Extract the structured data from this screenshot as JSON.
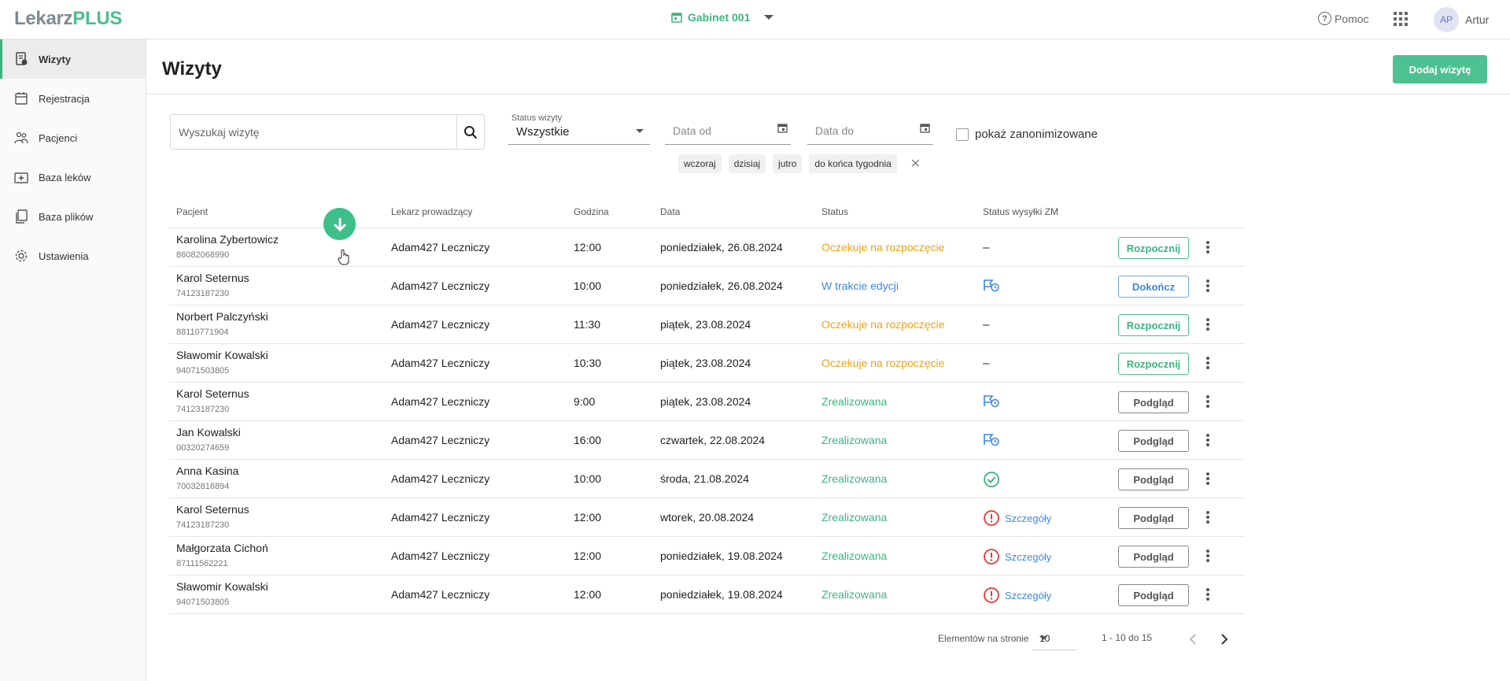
{
  "app": {
    "logo_main": "Lekarz",
    "logo_plus": "PLUS"
  },
  "topbar": {
    "cabinet": "Gabinet 001",
    "help": "Pomoc",
    "user_initials": "AP",
    "user_name": "Artur"
  },
  "sidebar": {
    "items": [
      {
        "label": "Wizyty",
        "icon": "document-icon",
        "active": true
      },
      {
        "label": "Rejestracja",
        "icon": "calendar-icon"
      },
      {
        "label": "Pacjenci",
        "icon": "people-icon"
      },
      {
        "label": "Baza leków",
        "icon": "medkit-icon"
      },
      {
        "label": "Baza plików",
        "icon": "files-icon"
      },
      {
        "label": "Ustawienia",
        "icon": "gear-icon"
      }
    ]
  },
  "header": {
    "title": "Wizyty",
    "add_button": "Dodaj wizytę"
  },
  "filters": {
    "search_placeholder": "Wyszukaj wizytę",
    "status_label": "Status wizyty",
    "status_value": "Wszystkie",
    "date_from": "Data od",
    "date_to": "Data do",
    "anon_label": "pokaż zanonimizowane",
    "chips": [
      "wczoraj",
      "dzisiaj",
      "jutro",
      "do końca tygodnia"
    ]
  },
  "table": {
    "headers": {
      "patient": "Pacjent",
      "doctor": "Lekarz prowadzący",
      "hour": "Godzina",
      "date": "Data",
      "status": "Status",
      "zm": "Status wysyłki ZM"
    },
    "rows": [
      {
        "name": "Karolina Zybertowicz",
        "pesel": "86082068990",
        "doctor": "Adam427 Leczniczy",
        "hour": "12:00",
        "date": "poniedziałek, 26.08.2024",
        "status": "Oczekuje na rozpoczęcie",
        "zm": "–",
        "action": "Rozpocznij"
      },
      {
        "name": "Karol Seternus",
        "pesel": "74123187230",
        "doctor": "Adam427 Leczniczy",
        "hour": "10:00",
        "date": "poniedziałek, 26.08.2024",
        "status": "W trakcie edycji",
        "zm": "",
        "action": "Dokończ"
      },
      {
        "name": "Norbert Palczyński",
        "pesel": "88110771904",
        "doctor": "Adam427 Leczniczy",
        "hour": "11:30",
        "date": "piątek, 23.08.2024",
        "status": "Oczekuje na rozpoczęcie",
        "zm": "–",
        "action": "Rozpocznij"
      },
      {
        "name": "Sławomir Kowalski",
        "pesel": "94071503805",
        "doctor": "Adam427 Leczniczy",
        "hour": "10:30",
        "date": "piątek, 23.08.2024",
        "status": "Oczekuje na rozpoczęcie",
        "zm": "–",
        "action": "Rozpocznij"
      },
      {
        "name": "Karol Seternus",
        "pesel": "74123187230",
        "doctor": "Adam427 Leczniczy",
        "hour": "9:00",
        "date": "piątek, 23.08.2024",
        "status": "Zrealizowana",
        "zm": "",
        "action": "Podgląd"
      },
      {
        "name": "Jan Kowalski",
        "pesel": "00320274659",
        "doctor": "Adam427 Leczniczy",
        "hour": "16:00",
        "date": "czwartek, 22.08.2024",
        "status": "Zrealizowana",
        "zm": "",
        "action": "Podgląd"
      },
      {
        "name": "Anna Kasina",
        "pesel": "70032816894",
        "doctor": "Adam427 Leczniczy",
        "hour": "10:00",
        "date": "środa, 21.08.2024",
        "status": "Zrealizowana",
        "zm": "",
        "action": "Podgląd"
      },
      {
        "name": "Karol Seternus",
        "pesel": "74123187230",
        "doctor": "Adam427 Leczniczy",
        "hour": "12:00",
        "date": "wtorek, 20.08.2024",
        "status": "Zrealizowana",
        "zm": "Szczegóły",
        "action": "Podgląd"
      },
      {
        "name": "Małgorzata Cichoń",
        "pesel": "87111562221",
        "doctor": "Adam427 Leczniczy",
        "hour": "12:00",
        "date": "poniedziałek, 19.08.2024",
        "status": "Zrealizowana",
        "zm": "Szczegóły",
        "action": "Podgląd"
      },
      {
        "name": "Sławomir Kowalski",
        "pesel": "94071503805",
        "doctor": "Adam427 Leczniczy",
        "hour": "12:00",
        "date": "poniedziałek, 19.08.2024",
        "status": "Zrealizowana",
        "zm": "Szczegóły",
        "action": "Podgląd"
      }
    ]
  },
  "pagination": {
    "per_page_label": "Elementów na stronie",
    "per_page": "10",
    "range": "1 - 10 do 15"
  },
  "colors": {
    "accent": "#4dc192",
    "waiting": "#f3a114",
    "editing": "#3e87e8",
    "done": "#3cb57e",
    "error": "#e53935"
  }
}
